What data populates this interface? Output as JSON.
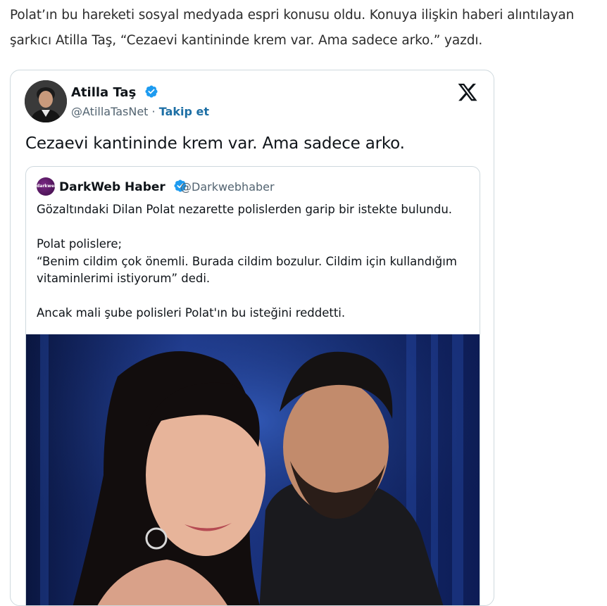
{
  "article": {
    "paragraph": "Polat’ın bu hareketi sosyal medyada espri konusu oldu. Konuya ilişkin haberi alıntılayan şarkıcı Atilla Taş, “Cezaevi kantininde krem var. Ama sadece arko.” yazdı."
  },
  "tweet": {
    "author_name": "Atilla Taş",
    "handle": "@AtillaTasNet",
    "separator": "·",
    "follow_label": "Takip et",
    "text": "Cezaevi kantininde krem var. Ama sadece arko.",
    "icons": [
      "verified-badge-icon",
      "x-logo-icon"
    ],
    "colors": {
      "verified": "#1d9bf0",
      "follow": "#1d6fa5",
      "border": "#cfd9de"
    }
  },
  "quoted_tweet": {
    "author_name": "DarkWeb Haber",
    "handle": "@Darkwebhaber",
    "avatar_text": "darkweb",
    "lines": {
      "line1": "Gözaltındaki Dilan Polat nezarette polislerden garip bir istekte bulundu.",
      "line2": "Polat polislere;",
      "line3": "“Benim cildim çok önemli. Burada cildim bozulur. Cildim için kullandığım vitaminlerimi istiyorum” dedi.",
      "line4": "Ancak mali şube polisleri Polat'ın bu isteğini reddetti."
    }
  }
}
